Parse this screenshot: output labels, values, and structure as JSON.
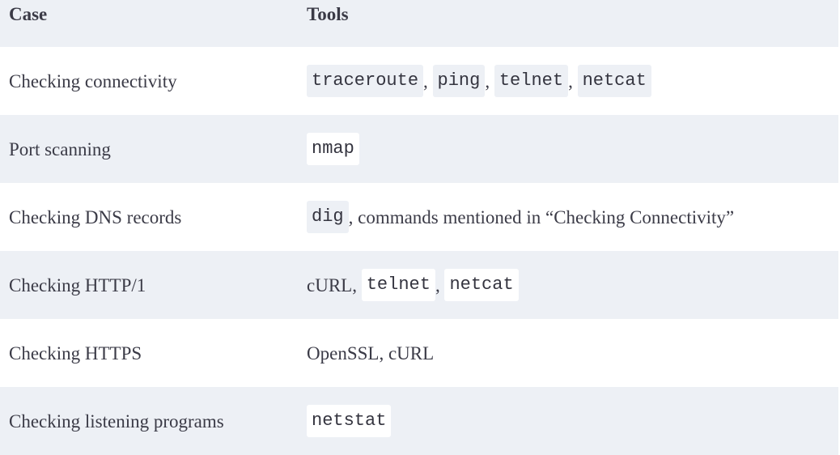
{
  "table": {
    "headers": {
      "case": "Case",
      "tools": "Tools"
    },
    "rows": [
      {
        "case": "Checking connectivity",
        "tools": [
          {
            "kind": "code",
            "text": "traceroute"
          },
          {
            "kind": "text",
            "text": ", "
          },
          {
            "kind": "code",
            "text": "ping"
          },
          {
            "kind": "text",
            "text": ", "
          },
          {
            "kind": "code",
            "text": "telnet"
          },
          {
            "kind": "text",
            "text": ", "
          },
          {
            "kind": "code",
            "text": "netcat"
          }
        ]
      },
      {
        "case": "Port scanning",
        "tools": [
          {
            "kind": "code",
            "text": "nmap"
          }
        ]
      },
      {
        "case": "Checking DNS records",
        "tools": [
          {
            "kind": "code",
            "text": "dig"
          },
          {
            "kind": "text",
            "text": ", commands mentioned in “Checking Connectivity”"
          }
        ]
      },
      {
        "case": "Checking HTTP/1",
        "tools": [
          {
            "kind": "text",
            "text": "cURL, "
          },
          {
            "kind": "code",
            "text": "telnet"
          },
          {
            "kind": "text",
            "text": ", "
          },
          {
            "kind": "code",
            "text": "netcat"
          }
        ]
      },
      {
        "case": "Checking HTTPS",
        "tools": [
          {
            "kind": "text",
            "text": "OpenSSL, cURL"
          }
        ]
      },
      {
        "case": "Checking listening programs",
        "tools": [
          {
            "kind": "code",
            "text": "netstat"
          }
        ]
      }
    ]
  }
}
